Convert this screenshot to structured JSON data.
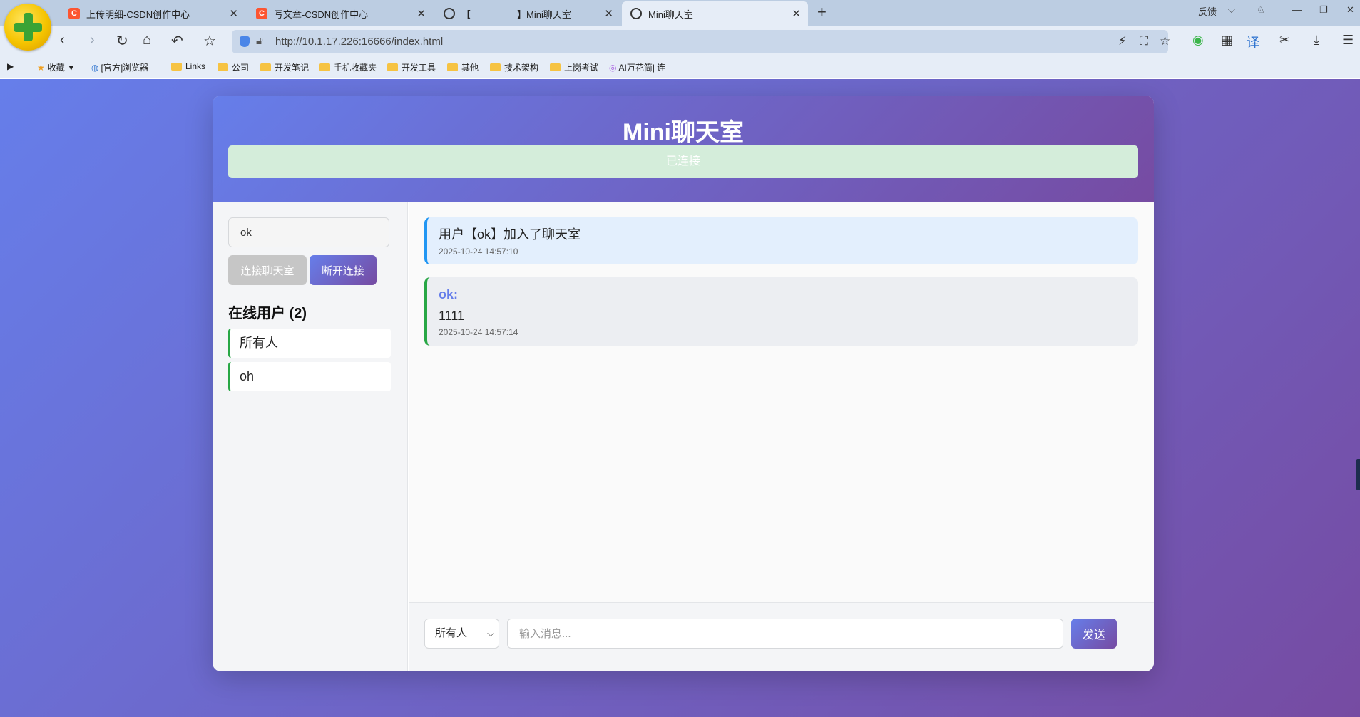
{
  "browser": {
    "tabs": [
      {
        "title": "上传明细-CSDN创作中心",
        "favicon": "csdn-icon"
      },
      {
        "title": "写文章-CSDN创作中心",
        "favicon": "csdn-icon"
      },
      {
        "title": "【　　　　　】Mini聊天室",
        "favicon": "globe-icon"
      },
      {
        "title": "Mini聊天室",
        "favicon": "globe-icon",
        "active": true
      }
    ],
    "feedback_label": "反馈",
    "url": "http://10.1.17.226:16666/index.html",
    "bookmarks": {
      "favorites": "收藏",
      "items": [
        "[官方]浏览器",
        "Links",
        "公司",
        "开发笔记",
        "手机收藏夹",
        "开发工具",
        "其他",
        "技术架构",
        "上岗考试",
        "AI万花筒| 连"
      ]
    }
  },
  "chat": {
    "title": "Mini聊天室",
    "status": "已连接",
    "status_color": "#d4edda",
    "username_value": "ok",
    "connect_label": "连接聊天室",
    "disconnect_label": "断开连接",
    "online_heading": "在线用户 (2)",
    "users": [
      "所有人",
      "oh"
    ],
    "messages": [
      {
        "type": "system",
        "text": "用户【ok】加入了聊天室",
        "time": "2025-10-24 14:57:10"
      },
      {
        "type": "user",
        "sender": "ok:",
        "text": "1111",
        "time": "2025-10-24 14:57:14"
      }
    ],
    "target_selected": "所有人",
    "input_placeholder": "输入消息...",
    "send_label": "发送",
    "accent_gradient": [
      "#667eea",
      "#764ba2"
    ]
  }
}
